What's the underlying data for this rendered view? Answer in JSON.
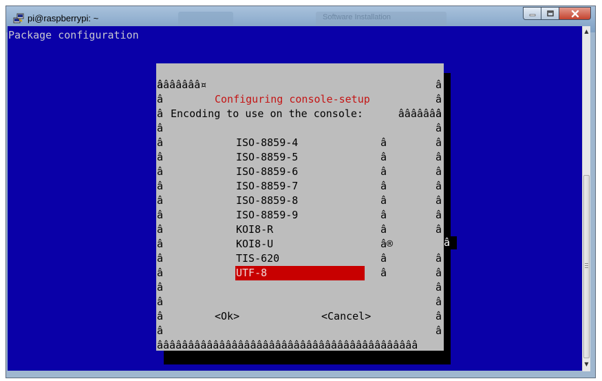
{
  "window": {
    "title": "pi@raspberrypi: ~",
    "background_title": "Software Installation",
    "controls": {
      "minimize": "minimize",
      "maximize": "maximize",
      "close": "close"
    }
  },
  "terminal": {
    "header": "Package configuration",
    "colors": {
      "background": "#0a00a8",
      "dialog": "#bdbdbd",
      "selection": "#c80000",
      "title": "#c41414"
    }
  },
  "dialog": {
    "title_prefix": "âââââââ¤",
    "title": "Configuring console-setup",
    "title_suffix": "âââââââ",
    "border_char": "â",
    "prompt": "Encoding to use on the console:",
    "items": [
      {
        "label": "ISO-8859-4",
        "mark": "â"
      },
      {
        "label": "ISO-8859-5",
        "mark": "â"
      },
      {
        "label": "ISO-8859-6",
        "mark": "â"
      },
      {
        "label": "ISO-8859-7",
        "mark": "â"
      },
      {
        "label": "ISO-8859-8",
        "mark": "â"
      },
      {
        "label": "ISO-8859-9",
        "mark": "â"
      },
      {
        "label": "KOI8-R",
        "mark": "â"
      },
      {
        "label": "KOI8-U",
        "mark": "â®"
      },
      {
        "label": "TIS-620",
        "mark": "â"
      },
      {
        "label": "UTF-8",
        "mark": "â",
        "selected": true
      }
    ],
    "ok_button": "<Ok>",
    "cancel_button": "<Cancel>",
    "bottom_border": "ââââââââââââââââââââââââââââââââââââââââââ",
    "cursor_char": "â"
  }
}
